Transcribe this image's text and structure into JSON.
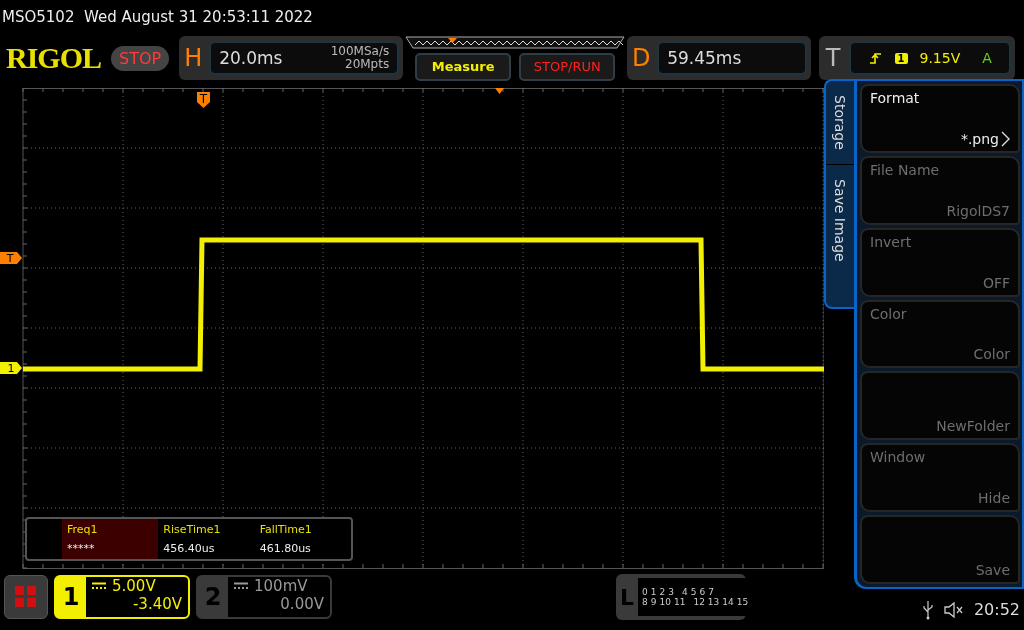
{
  "header": {
    "model": "MSO5102",
    "datetime": "Wed August 31 20:53:11 2022"
  },
  "logo": "RIGOL",
  "run_state": "STOP",
  "horizontal": {
    "label": "H",
    "timebase": "20.0ms",
    "sample_rate": "100MSa/s",
    "memory_depth": "20Mpts"
  },
  "buttons": [
    {
      "label": "Measure",
      "kind": "measure"
    },
    {
      "label": "STOP/RUN",
      "kind": "run"
    }
  ],
  "delay": {
    "label": "D",
    "value": "59.45ms"
  },
  "trigger": {
    "label": "T",
    "source": "1",
    "level": "9.15V",
    "mode": "A"
  },
  "markers": {
    "trigger_position": "T",
    "trigger_level": "T",
    "channel": "1"
  },
  "measurements": [
    {
      "name": "Freq1",
      "value": "*****",
      "selected": true
    },
    {
      "name": "RiseTime1",
      "value": "456.40us",
      "selected": false
    },
    {
      "name": "FallTime1",
      "value": "461.80us",
      "selected": false
    }
  ],
  "side_tabs": [
    {
      "label": "Storage"
    },
    {
      "label": "Save Image"
    }
  ],
  "menu": [
    {
      "title": "Format",
      "value": "*.png",
      "submenu": true,
      "disabled": false
    },
    {
      "title": "File Name",
      "value": "RigolDS7",
      "submenu": false,
      "disabled": true
    },
    {
      "title": "Invert",
      "value": "OFF",
      "submenu": false,
      "disabled": true
    },
    {
      "title": "Color",
      "value": "Color",
      "submenu": false,
      "disabled": true
    },
    {
      "value": "NewFolder",
      "submenu": false,
      "disabled": true
    },
    {
      "title": "Window",
      "value": "Hide",
      "submenu": false,
      "disabled": true
    },
    {
      "value": "Save",
      "submenu": false,
      "disabled": true
    }
  ],
  "channels": [
    {
      "number": "1",
      "scale": "5.00V",
      "offset": "-3.40V",
      "active": true
    },
    {
      "number": "2",
      "scale": "100mV",
      "offset": "0.00V",
      "active": false
    }
  ],
  "logic": {
    "label": "L",
    "bits": [
      "0",
      "1",
      "2",
      "3",
      "4",
      "5",
      "6",
      "7",
      "8",
      "9",
      "10",
      "11",
      "12",
      "13",
      "14",
      "15"
    ]
  },
  "status": {
    "time": "20:52"
  }
}
